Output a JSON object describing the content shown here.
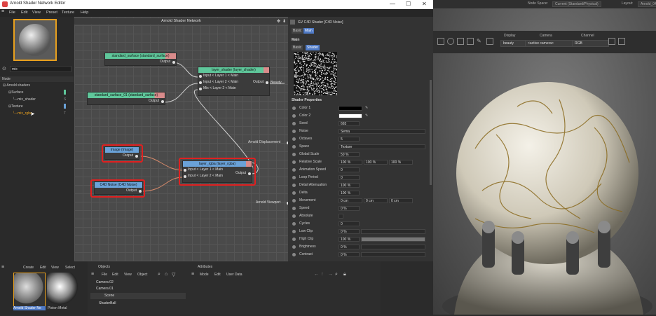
{
  "main_top": {
    "node_space_label": "Node Space:",
    "node_space_value": "Current (Standard/Physical)",
    "layout_label": "Layout:",
    "layout_value": "Arnold_04"
  },
  "viewport_toolbar": {
    "display_label": "Display",
    "display_value": "beauty",
    "camera_label": "Camera",
    "camera_value": "<active camera>",
    "channel_label": "Channel",
    "channel_value": "RGB"
  },
  "window": {
    "title": "Arnold Shader Network Editor",
    "minimize": "—",
    "maximize": "☐",
    "close": "✕",
    "menu": [
      "File",
      "Edit",
      "View",
      "Preset",
      "Texture",
      "Help"
    ]
  },
  "left_panel": {
    "search_value": "mix",
    "header": "Node",
    "tree": [
      {
        "label": "Arnold shaders",
        "level": 0
      },
      {
        "label": "Surface",
        "level": 1
      },
      {
        "label": "mix_shader",
        "level": 2
      },
      {
        "label": "Texture",
        "level": 1
      },
      {
        "label": "mix_rgba",
        "level": 2
      }
    ]
  },
  "canvas": {
    "title": "Arnold Shader Network",
    "side_labels": {
      "displacement": "Arnold Displacement",
      "viewport": "Arnold Viewport",
      "beauty": "Beauty"
    },
    "nodes": {
      "ss": {
        "title": "standard_surface (standard_surface)",
        "ports": [
          "Output"
        ]
      },
      "ss01": {
        "title": "standard_surface_01 (standard_surface)",
        "ports": [
          "Output"
        ]
      },
      "layer_shader": {
        "title": "layer_shader (layer_shader)",
        "ports": [
          "Input < Layer 1 < Main",
          "Input < Layer 2 < Main",
          "Mix < Layer 2 < Main",
          "Output"
        ]
      },
      "image": {
        "title": "Image (Image)",
        "ports": [
          "Output"
        ]
      },
      "c4dnoise": {
        "title": "C4D Noise (C4D Noise)",
        "ports": [
          "Output"
        ]
      },
      "layer_rgba": {
        "title": "layer_rgba (layer_rgba)",
        "ports": [
          "Input < Layer 1 < Main",
          "Input < Layer 2 < Main",
          "Output"
        ]
      }
    }
  },
  "attributes": {
    "title": "GV C4D Shader [C4D Noise]",
    "tabs": [
      "Basic",
      "Main"
    ],
    "section_main": "Main",
    "sub_tabs": [
      "Basic",
      "Shader"
    ],
    "section_props": "Shader Properties",
    "rows": [
      {
        "name": "Color 1",
        "v": ""
      },
      {
        "name": "Color 2",
        "v": ""
      },
      {
        "name": "Seed",
        "v": "665"
      },
      {
        "name": "Noise",
        "v": "Sema"
      },
      {
        "name": "Octaves",
        "v": "5"
      },
      {
        "name": "Space",
        "v": "Texture"
      },
      {
        "name": "Global Scale",
        "v": "50 %"
      },
      {
        "name": "Relative Scale",
        "v": "100 %",
        "v2": "100 %",
        "v3": "100 %"
      },
      {
        "name": "Animation Speed",
        "v": "0"
      },
      {
        "name": "Loop Period",
        "v": "0"
      },
      {
        "name": "Detail Attenuation",
        "v": "100 %"
      },
      {
        "name": "Delta",
        "v": "100 %"
      },
      {
        "name": "Movement",
        "v": "0 cm",
        "v2": "0 cm",
        "v3": "0 cm"
      },
      {
        "name": "Speed",
        "v": "0 %"
      },
      {
        "name": "Absolute",
        "v": ""
      },
      {
        "name": "Cycles",
        "v": "0"
      },
      {
        "name": "Low Clip",
        "v": "0 %"
      },
      {
        "name": "High Clip",
        "v": "100 %"
      },
      {
        "name": "Brightness",
        "v": "0 %"
      },
      {
        "name": "Contrast",
        "v": "0 %"
      }
    ]
  },
  "bottom": {
    "mat_menu": [
      "Create",
      "Edit",
      "View",
      "Select"
    ],
    "mat_items": [
      "Arnold Shader Ne",
      "Piston Metal"
    ],
    "obj_title": "Objects",
    "obj_menu": [
      "File",
      "Edit",
      "View",
      "Object"
    ],
    "objects": [
      "Camera 02",
      "Camera 01",
      "Scene",
      "ShaderBall"
    ],
    "att_title": "Attributes",
    "att_menu": [
      "Mode",
      "Edit",
      "User Data"
    ]
  },
  "colors": {
    "accent": "#4e79c5",
    "selection_orange": "#e8a01e",
    "highlight_red": "#e02020",
    "node_green": "#5fc79b",
    "node_blue": "#6aa2d8",
    "node_pink": "#d98b8b"
  }
}
